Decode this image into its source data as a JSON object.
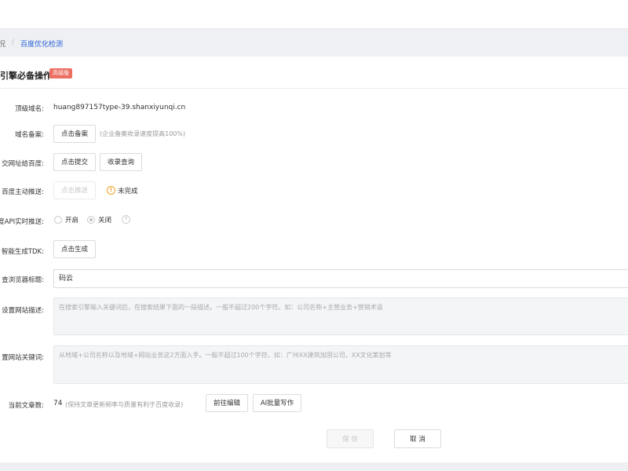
{
  "breadcrumb": {
    "prev": "况",
    "current": "百度优化检测"
  },
  "section": {
    "title": "引擎必备操作",
    "badge": "高级版"
  },
  "rows": {
    "domain": {
      "label": "顶级域名:",
      "value": "huang897157type-39.shanxiyunqi.cn"
    },
    "filing": {
      "label": "域名备案:",
      "button": "点击备案",
      "hint": "(企业备案收录速度提高100%)"
    },
    "submit": {
      "label": "交网址给百度:",
      "button1": "点击提交",
      "button2": "收录查询"
    },
    "push": {
      "label": "百度主动推送:",
      "button": "点击推送",
      "status": "未完成",
      "status_color": "#f0a020"
    },
    "api": {
      "label": "度API实时推送:",
      "option_on": "开启",
      "option_off": "关闭",
      "selected": "关闭",
      "help": "?"
    },
    "tdk": {
      "label": "智能生成TDK:",
      "button": "点击生成"
    },
    "browser_title": {
      "label": "查浏览器标题:",
      "value": "码云"
    },
    "site_desc": {
      "label": "设置网站描述:",
      "placeholder": "在搜索引擎输入关键词后，在搜索结果下面的一段描述。一般不超过200个字符。如：公司名称+主营业务+营销术语"
    },
    "site_keywords": {
      "label": "置网站关键词:",
      "placeholder": "从地域+公司名称以及地域+网站业务这2方面入手。一般不超过100个字符。如：广州XX建筑加固公司，XX文化策划等"
    },
    "articles": {
      "label": "当前文章数:",
      "count": "74",
      "hint": "(保持文章更新频率与质量有利于百度收录)",
      "button1": "前往编辑",
      "button2": "AI批量写作"
    }
  },
  "footer": {
    "save": "保 存",
    "cancel": "取 消"
  },
  "colors": {
    "accent": "#2b63d9",
    "badge": "#ec6f61",
    "warning": "#f0a020"
  },
  "icons": {
    "warning": "warning-circle-icon",
    "help": "question-circle-icon"
  }
}
